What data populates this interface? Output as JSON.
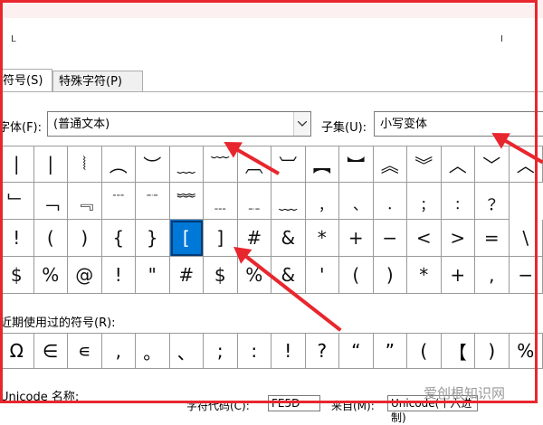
{
  "window": {
    "corner_left": "L",
    "corner_right": "I"
  },
  "tabs": [
    {
      "label": "符号(S)",
      "active": true
    },
    {
      "label": "特殊字符(P)",
      "active": false
    }
  ],
  "font": {
    "label": "字体(F):",
    "value": "(普通文本)"
  },
  "subset": {
    "label": "子集(U):",
    "value": "小写变体"
  },
  "grid": [
    [
      "|",
      "|",
      "⦚",
      "︵",
      "︶",
      "﹏",
      "﹋",
      "︹",
      "︺",
      "︻",
      "︼",
      "︽",
      "︾",
      "︿",
      "﹀",
      "︿"
    ],
    [
      "﹂",
      "﹁",
      "﹃",
      "﹉",
      "﹊",
      "﹌",
      "﹍",
      "﹎",
      "﹏",
      "﹐",
      "﹑",
      "﹒",
      "﹔",
      "﹕",
      "﹖"
    ],
    [
      "!",
      "(",
      ")",
      "{",
      "}",
      "[",
      "]",
      "#",
      "&",
      "*",
      "+",
      "−",
      "<",
      ">",
      "=",
      "\\"
    ],
    [
      "$",
      "%",
      "@",
      "!",
      "\"",
      "#",
      "$",
      "%",
      "&",
      "'",
      "(",
      ")",
      "*",
      "+",
      ",",
      "−"
    ]
  ],
  "selected": {
    "row": 2,
    "col": 5
  },
  "recent": {
    "label": "近期使用过的符号(R):",
    "items": [
      "Ω",
      "∈",
      "∊",
      ",",
      "。",
      "、",
      ";",
      ":",
      "!",
      "?",
      "“",
      "”",
      "(",
      "【",
      ")",
      "%"
    ]
  },
  "unicode": {
    "label": "Unicode 名称:",
    "code_label": "字符代码(C):",
    "code_value": "FE5D",
    "from_label": "来自(M):",
    "from_value": "Unicode(十六进制)"
  },
  "watermark": "爱创根知识网",
  "colors": {
    "annotation": "#e8262e",
    "selection": "#0078d7"
  }
}
